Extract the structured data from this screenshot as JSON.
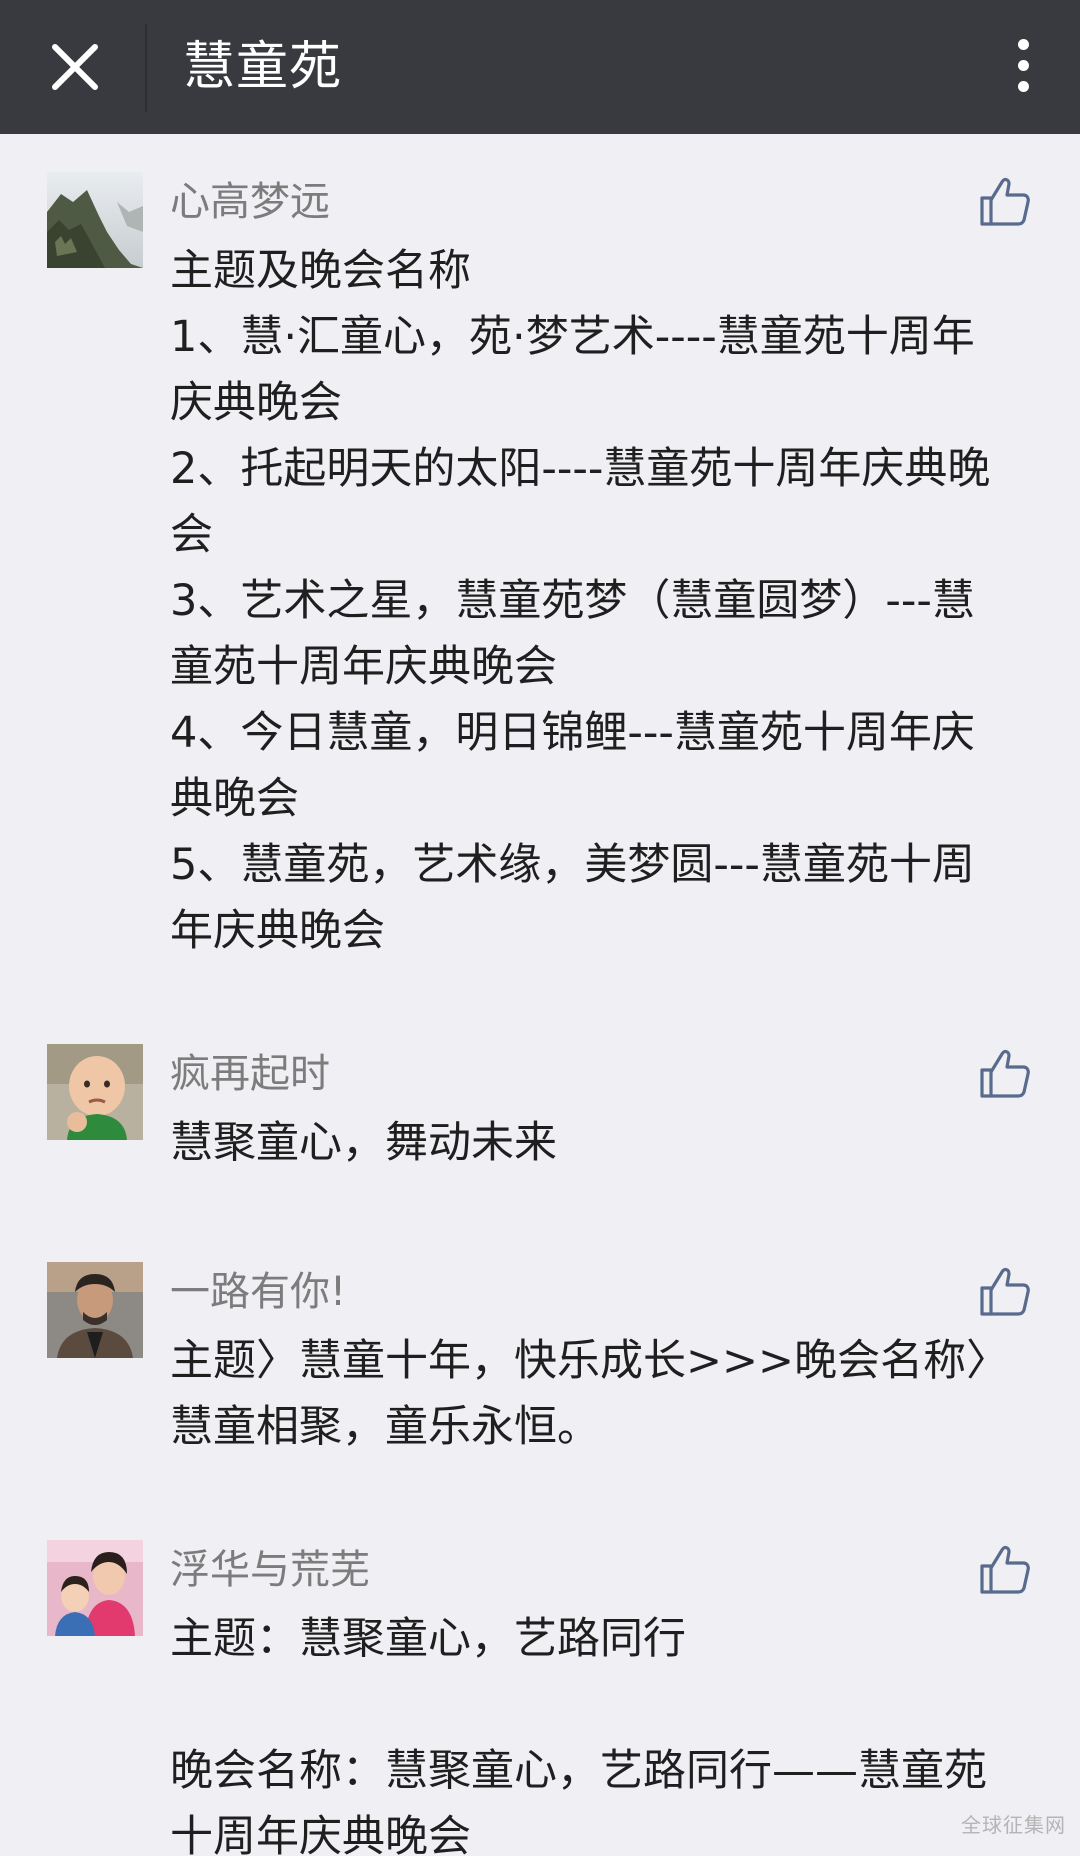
{
  "header": {
    "title": "慧童苑",
    "close_icon": "close-icon",
    "more_icon": "more-vertical-icon",
    "background": "#393a3f"
  },
  "comments": [
    {
      "nickname": "心高梦远",
      "avatar": "avatar-mountain-landscape",
      "like_icon": "thumbs-up-icon",
      "paragraphs": [
        "主题及晚会名称",
        "1、慧·汇童心，苑·梦艺术----慧童苑十周年庆典晚会",
        "2、托起明天的太阳----慧童苑十周年庆典晚会",
        "3、艺术之星，慧童苑梦（慧童圆梦）---慧童苑十周年庆典晚会",
        "4、今日慧童，明日锦鲤---慧童苑十周年庆典晚会",
        "5、慧童苑，艺术缘，美梦圆---慧童苑十周年庆典晚会"
      ]
    },
    {
      "nickname": "疯再起时",
      "avatar": "avatar-baby-fist",
      "like_icon": "thumbs-up-icon",
      "paragraphs": [
        "慧聚童心，舞动未来"
      ]
    },
    {
      "nickname": "一路有你!",
      "avatar": "avatar-man-portrait",
      "like_icon": "thumbs-up-icon",
      "paragraphs": [
        "主题〉慧童十年，快乐成长>>>晚会名称〉慧童相聚，童乐永恒。"
      ]
    },
    {
      "nickname": "浮华与荒芜",
      "avatar": "avatar-mother-child",
      "like_icon": "thumbs-up-icon",
      "paragraphs": [
        "主题：慧聚童心，艺路同行",
        "",
        "晚会名称：慧聚童心，艺路同行——慧童苑十周年庆典晚会"
      ]
    }
  ],
  "watermark": "全球征集网"
}
